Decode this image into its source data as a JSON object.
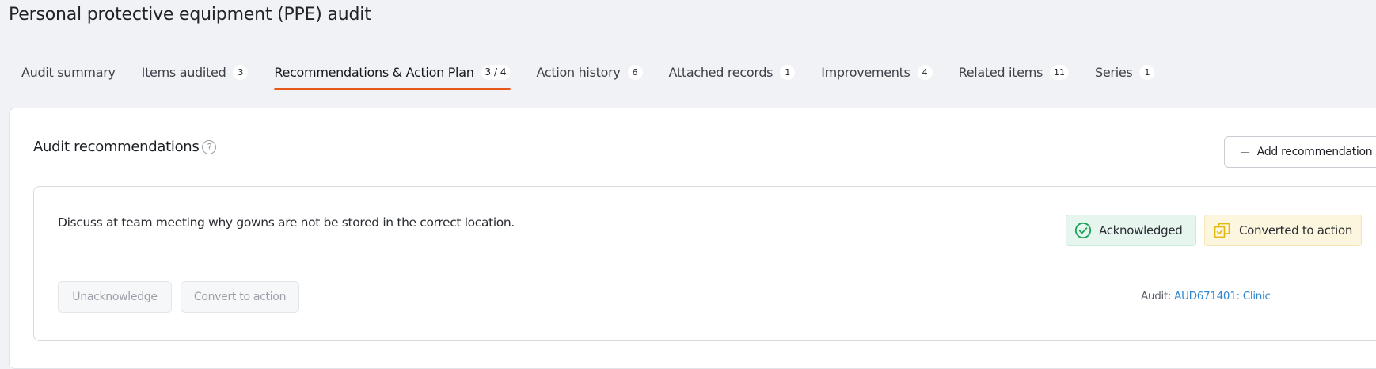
{
  "page": {
    "title": "Personal protective equipment (PPE) audit"
  },
  "tabs": [
    {
      "label": "Audit summary",
      "badge": null
    },
    {
      "label": "Items audited",
      "badge": "3"
    },
    {
      "label": "Recommendations & Action Plan",
      "badge": "3 / 4",
      "active": true
    },
    {
      "label": "Action history",
      "badge": "6"
    },
    {
      "label": "Attached records",
      "badge": "1"
    },
    {
      "label": "Improvements",
      "badge": "4"
    },
    {
      "label": "Related items",
      "badge": "11"
    },
    {
      "label": "Series",
      "badge": "1"
    }
  ],
  "section": {
    "title": "Audit recommendations",
    "help": "?",
    "add_button": {
      "icon": "+",
      "label": "Add recommendation"
    }
  },
  "recommendation": {
    "text": "Discuss at team meeting why gowns are not be stored in the correct location.",
    "status_acknowledged": "Acknowledged",
    "status_converted": "Converted to action",
    "unacknowledge_button": "Unacknowledge",
    "convert_button": "Convert to action",
    "audit_label": "Audit:",
    "audit_link": "AUD671401: Clinic"
  },
  "colors": {
    "accent": "#e8571a",
    "acknowledged_bg": "#e6f6ee",
    "acknowledged_icon": "#18a25a",
    "converted_bg": "#fdf6df",
    "converted_icon": "#e3b80f",
    "link": "#2e86d1"
  }
}
